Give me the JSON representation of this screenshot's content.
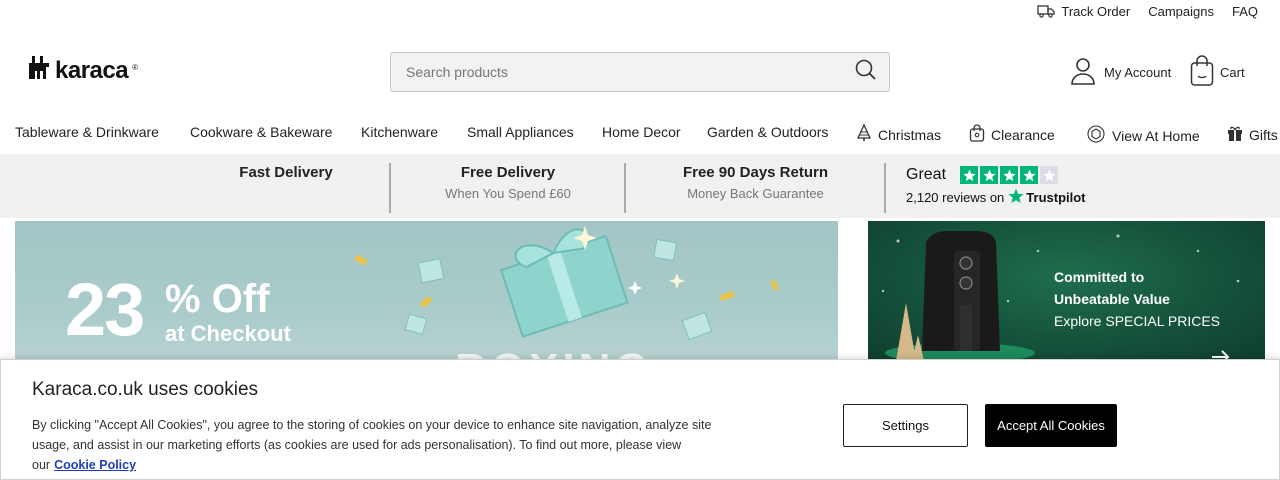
{
  "utility": {
    "track_order": "Track Order",
    "campaigns": "Campaigns",
    "faq": "FAQ"
  },
  "header": {
    "logo_text": "karaca",
    "logo_mark": "®",
    "search_placeholder": "Search products",
    "account_label": "My Account",
    "cart_label": "Cart"
  },
  "categories": [
    {
      "label": "Tableware & Drinkware",
      "icon": ""
    },
    {
      "label": "Cookware & Bakeware",
      "icon": ""
    },
    {
      "label": "Kitchenware",
      "icon": ""
    },
    {
      "label": "Small Appliances",
      "icon": ""
    },
    {
      "label": "Home Decor",
      "icon": ""
    },
    {
      "label": "Garden & Outdoors",
      "icon": ""
    },
    {
      "label": "Christmas",
      "icon": "tree-icon"
    },
    {
      "label": "Clearance",
      "icon": "bag-icon"
    },
    {
      "label": "View At Home",
      "icon": "ar-icon"
    },
    {
      "label": "Gifts",
      "icon": "gift-icon"
    }
  ],
  "benefits": [
    {
      "title": "Fast Delivery",
      "subtitle": ""
    },
    {
      "title": "Free Delivery",
      "subtitle": "When You Spend £60"
    },
    {
      "title": "Free 90 Days Return",
      "subtitle": "Money Back Guarantee"
    }
  ],
  "trustpilot": {
    "rating_word": "Great",
    "stars": 4,
    "reviews_text": "2,120 reviews on",
    "brand": "Trustpilot",
    "star_color": "#00b67a"
  },
  "hero": {
    "number": "23",
    "percent_off": "% Off",
    "subtitle": "at Checkout",
    "partial_text": "BOXING"
  },
  "side_banner": {
    "line1": "Committed to",
    "line2": "Unbeatable Value",
    "line3": "Explore SPECIAL PRICES"
  },
  "cookie": {
    "title": "Karaca.co.uk uses cookies",
    "body": "By clicking \"Accept All Cookies\", you agree to the storing of cookies on your device to enhance site navigation, analyze site usage, and assist in our marketing efforts (as cookies are used for ads personalisation). To find out more, please view our",
    "link": "Cookie Policy",
    "settings_label": "Settings",
    "accept_label": "Accept All Cookies"
  }
}
